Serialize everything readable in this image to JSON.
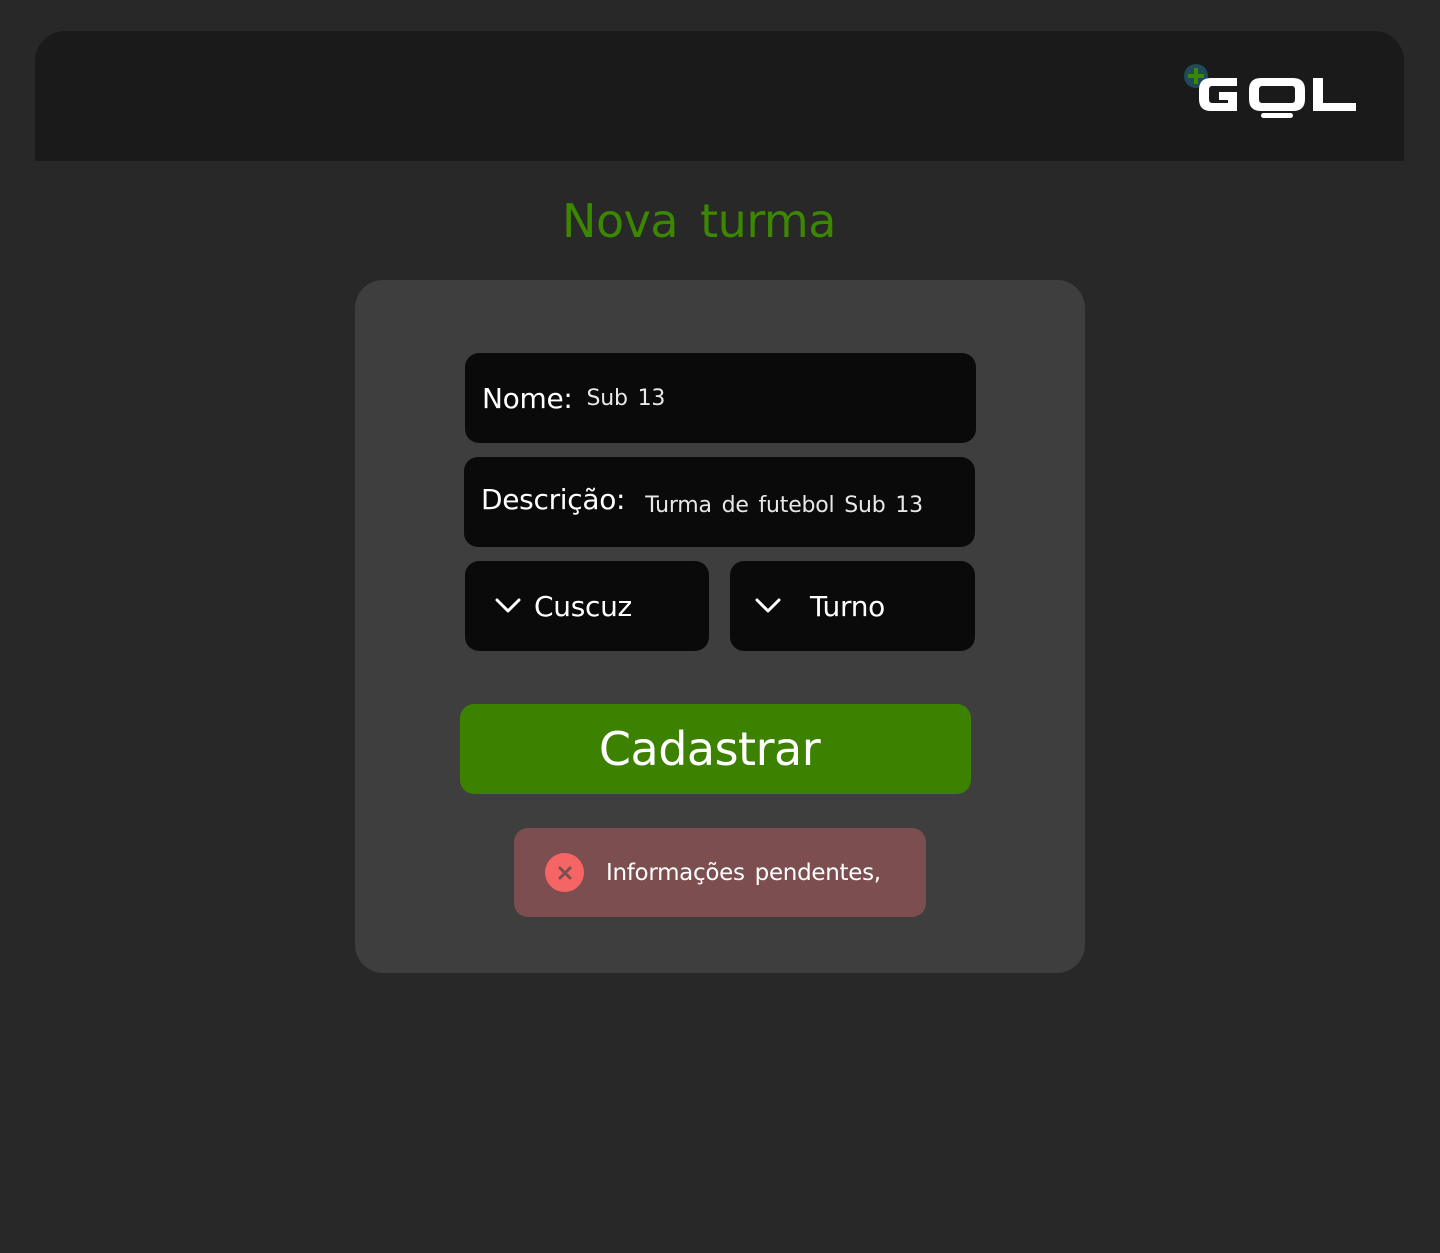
{
  "header": {
    "logo_text": "GOL",
    "logo_colors": {
      "plus": "#3c8700",
      "plus_ring": "#1f4a5a",
      "text": "#ffffff"
    }
  },
  "page": {
    "title": "Nova turma"
  },
  "form": {
    "name_field": {
      "label": "Nome:",
      "value": "Sub 13"
    },
    "description_field": {
      "label": "Descrição:",
      "value": "Turma de futebol Sub 13"
    },
    "selects": [
      {
        "selected": "Cuscuz",
        "icon": "chevron-down-icon"
      },
      {
        "selected": "Turno",
        "icon": "chevron-down-icon"
      }
    ],
    "submit_label": "Cadastrar"
  },
  "alert": {
    "icon": "error-icon",
    "message": "Informações pendentes,"
  },
  "colors": {
    "background": "#282828",
    "header": "#1a1a1a",
    "card": "#3e3e3e",
    "field": "#0a0a0a",
    "accent_green": "#3c8200",
    "alert_bg": "#7d4e50",
    "alert_icon": "#f66566"
  }
}
